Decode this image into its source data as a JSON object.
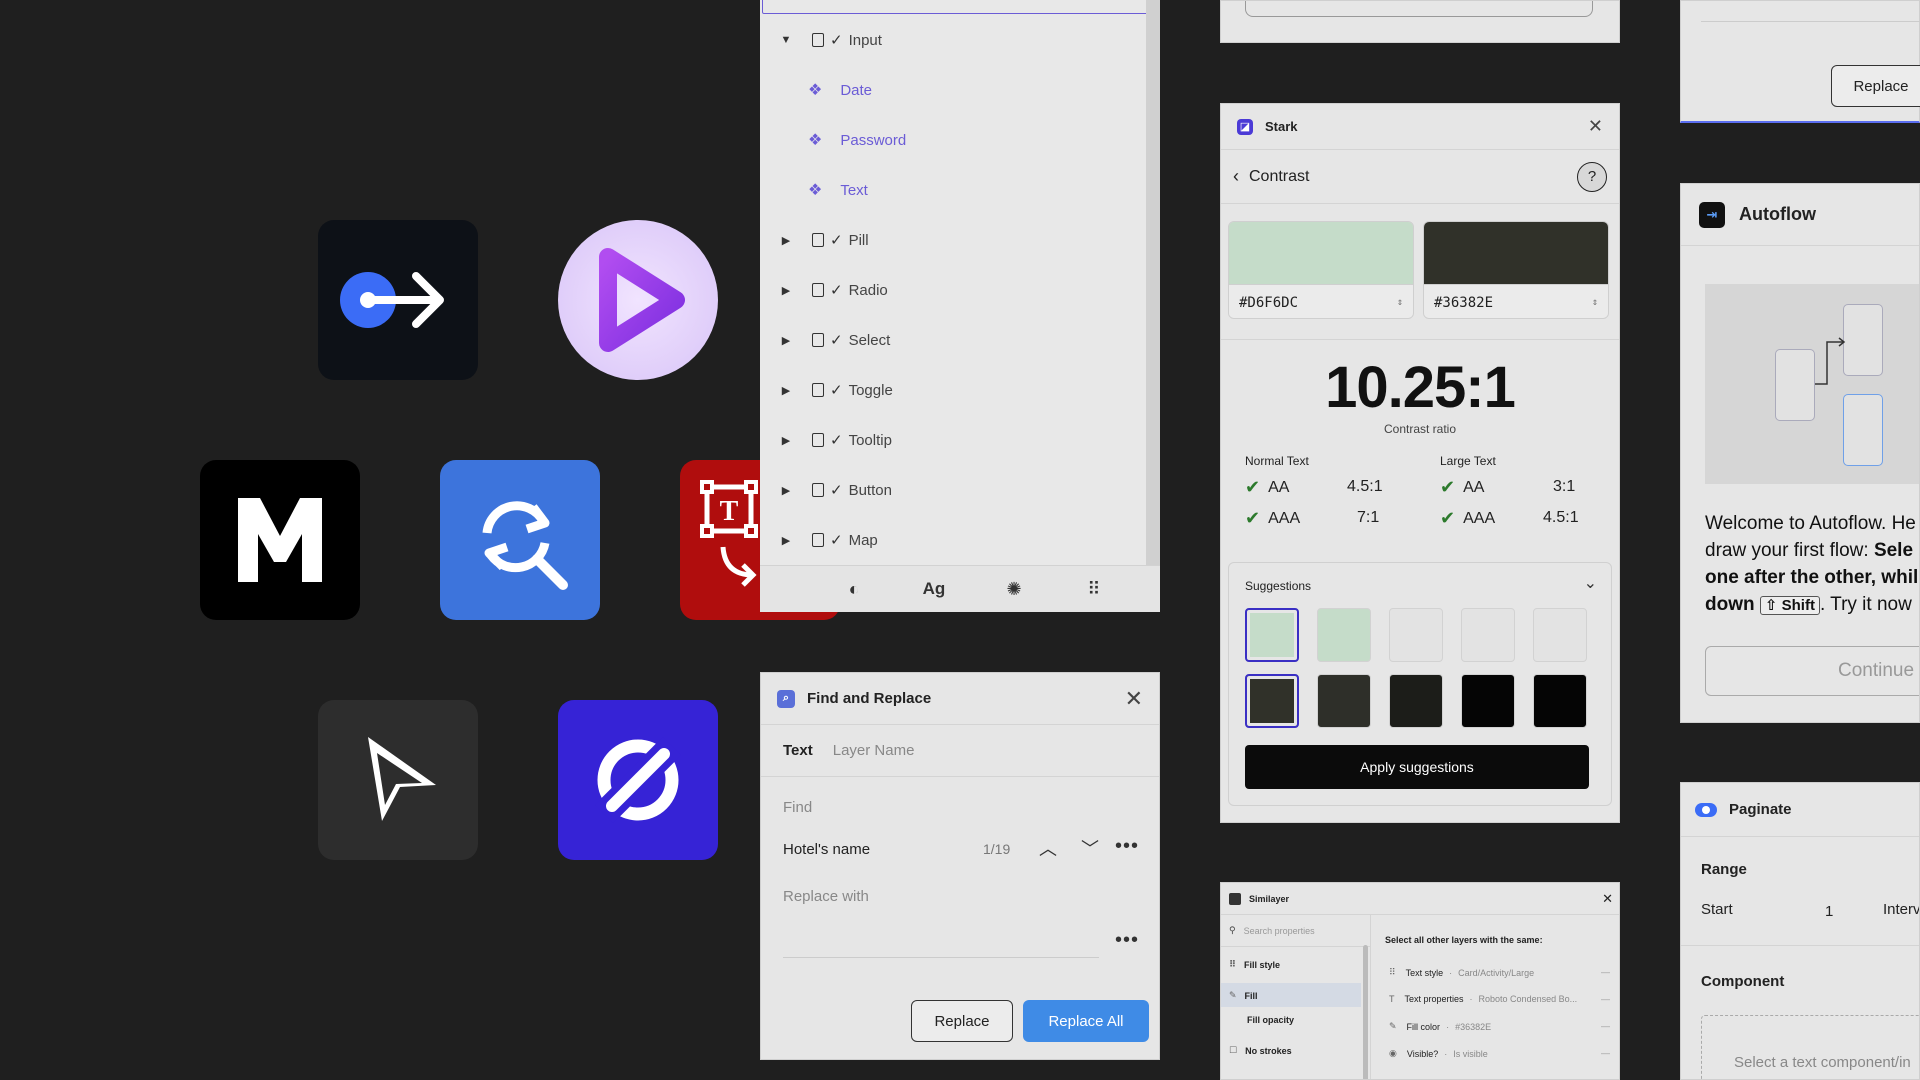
{
  "layers": {
    "items": [
      {
        "label": "Input",
        "type": "frame",
        "expanded": true
      },
      {
        "label": "Date",
        "type": "component"
      },
      {
        "label": "Password",
        "type": "component"
      },
      {
        "label": "Text",
        "type": "component"
      },
      {
        "label": "Pill",
        "type": "frame"
      },
      {
        "label": "Radio",
        "type": "frame"
      },
      {
        "label": "Select",
        "type": "frame"
      },
      {
        "label": "Toggle",
        "type": "frame"
      },
      {
        "label": "Tooltip",
        "type": "frame"
      },
      {
        "label": "Button",
        "type": "frame"
      },
      {
        "label": "Map",
        "type": "frame"
      }
    ],
    "toolbar": {
      "text_icon": "Ag"
    }
  },
  "icons": [
    "logout-arrow-icon",
    "play-icon",
    "m-logo-icon",
    "find-replace-icon",
    "text-swap-icon",
    "cursor-arrow-icon",
    "null-slash-icon"
  ],
  "find_replace": {
    "title": "Find and Replace",
    "tabs": [
      "Text",
      "Layer Name"
    ],
    "find_label": "Find",
    "find_value": "Hotel's name",
    "match_count": "1/19",
    "replace_label": "Replace with",
    "replace_button": "Replace",
    "replace_all_button": "Replace All"
  },
  "stark": {
    "title": "Stark",
    "section": "Contrast",
    "fg_hex": "#D6F6DC",
    "bg_hex": "#36382E",
    "fg_color": "#c5dcc9",
    "bg_color": "#303129",
    "ratio": "10.25:1",
    "ratio_label": "Contrast ratio",
    "normal_text": "Normal Text",
    "large_text": "Large Text",
    "normal": [
      {
        "level": "AA",
        "req": "4.5:1"
      },
      {
        "level": "AAA",
        "req": "7:1"
      }
    ],
    "large": [
      {
        "level": "AA",
        "req": "3:1"
      },
      {
        "level": "AAA",
        "req": "4.5:1"
      }
    ],
    "suggestions_label": "Suggestions",
    "apply_button": "Apply suggestions"
  },
  "top_stub": {
    "replace_button": "Replace"
  },
  "similayer": {
    "title": "Similayer",
    "search_placeholder": "Search properties",
    "left_items": [
      "Fill style",
      "Fill",
      "Fill opacity",
      "No strokes"
    ],
    "heading": "Select all other layers with the same:",
    "rows": [
      {
        "label": "Text style",
        "value": "Card/Activity/Large"
      },
      {
        "label": "Text properties",
        "value": "Roboto Condensed Bo..."
      },
      {
        "label": "Fill color",
        "value": "#36382E"
      },
      {
        "label": "Visible?",
        "value": "Is visible"
      }
    ]
  },
  "autoflow": {
    "title": "Autoflow",
    "line1": "Welcome to Autoflow. He",
    "line2a": "draw your first flow: ",
    "line2b": "Sele",
    "line3": "one after the other, whil",
    "line4a": "down",
    "key": "⇧ Shift",
    "line4b": ". Try it now",
    "continue": "Continue"
  },
  "paginate": {
    "title": "Paginate",
    "range": "Range",
    "start_label": "Start",
    "start_value": "1",
    "interval_label": "Interval",
    "component": "Component",
    "component_placeholder": "Select a text component/in"
  }
}
